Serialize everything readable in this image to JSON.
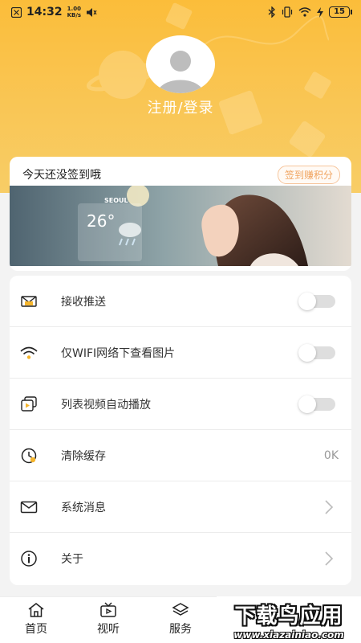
{
  "status_bar": {
    "time": "14:32",
    "net_speed_value": "1.00",
    "net_speed_unit": "KB/s",
    "battery": "15"
  },
  "profile": {
    "login_label": "注册/登录"
  },
  "signin": {
    "title": "今天还没签到哦",
    "badge": "签到赚积分"
  },
  "banner": {
    "city": "SEOUL",
    "temperature": "26°"
  },
  "settings": {
    "items": [
      {
        "label": "接收推送",
        "icon": "push-envelope-icon",
        "control": "toggle"
      },
      {
        "label": "仅WIFI网络下查看图片",
        "icon": "wifi-icon",
        "control": "toggle"
      },
      {
        "label": "列表视频自动播放",
        "icon": "video-play-icon",
        "control": "toggle"
      },
      {
        "label": "清除缓存",
        "icon": "clock-clean-icon",
        "control": "value",
        "value": "0K"
      },
      {
        "label": "系统消息",
        "icon": "mail-icon",
        "control": "chevron"
      },
      {
        "label": "关于",
        "icon": "info-icon",
        "control": "chevron"
      }
    ]
  },
  "tabs": [
    {
      "label": "首页",
      "icon": "home-icon"
    },
    {
      "label": "视听",
      "icon": "tv-icon"
    },
    {
      "label": "服务",
      "icon": "layers-icon"
    }
  ],
  "watermark": {
    "main": "下载鸟应用",
    "url": "www.xiazainiao.com"
  },
  "colors": {
    "header": "#fbbd3a",
    "accent_badge": "#f0a35e",
    "toggle_off": "#dedede"
  }
}
